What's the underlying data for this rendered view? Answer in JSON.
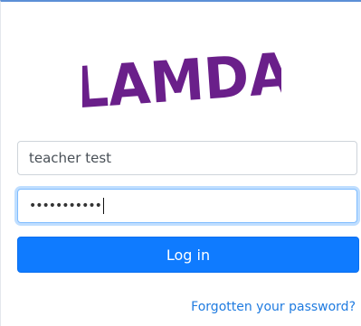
{
  "logo": {
    "text": "LAMDA",
    "color": "#6a1f8a"
  },
  "form": {
    "username_value": "teacher test",
    "password_masked": "•••••••••••",
    "login_label": "Log in",
    "forgot_label": "Forgotten your password?"
  },
  "colors": {
    "primary": "#0f7bff",
    "link": "#1f7be0",
    "focus_border": "#80bdff"
  }
}
